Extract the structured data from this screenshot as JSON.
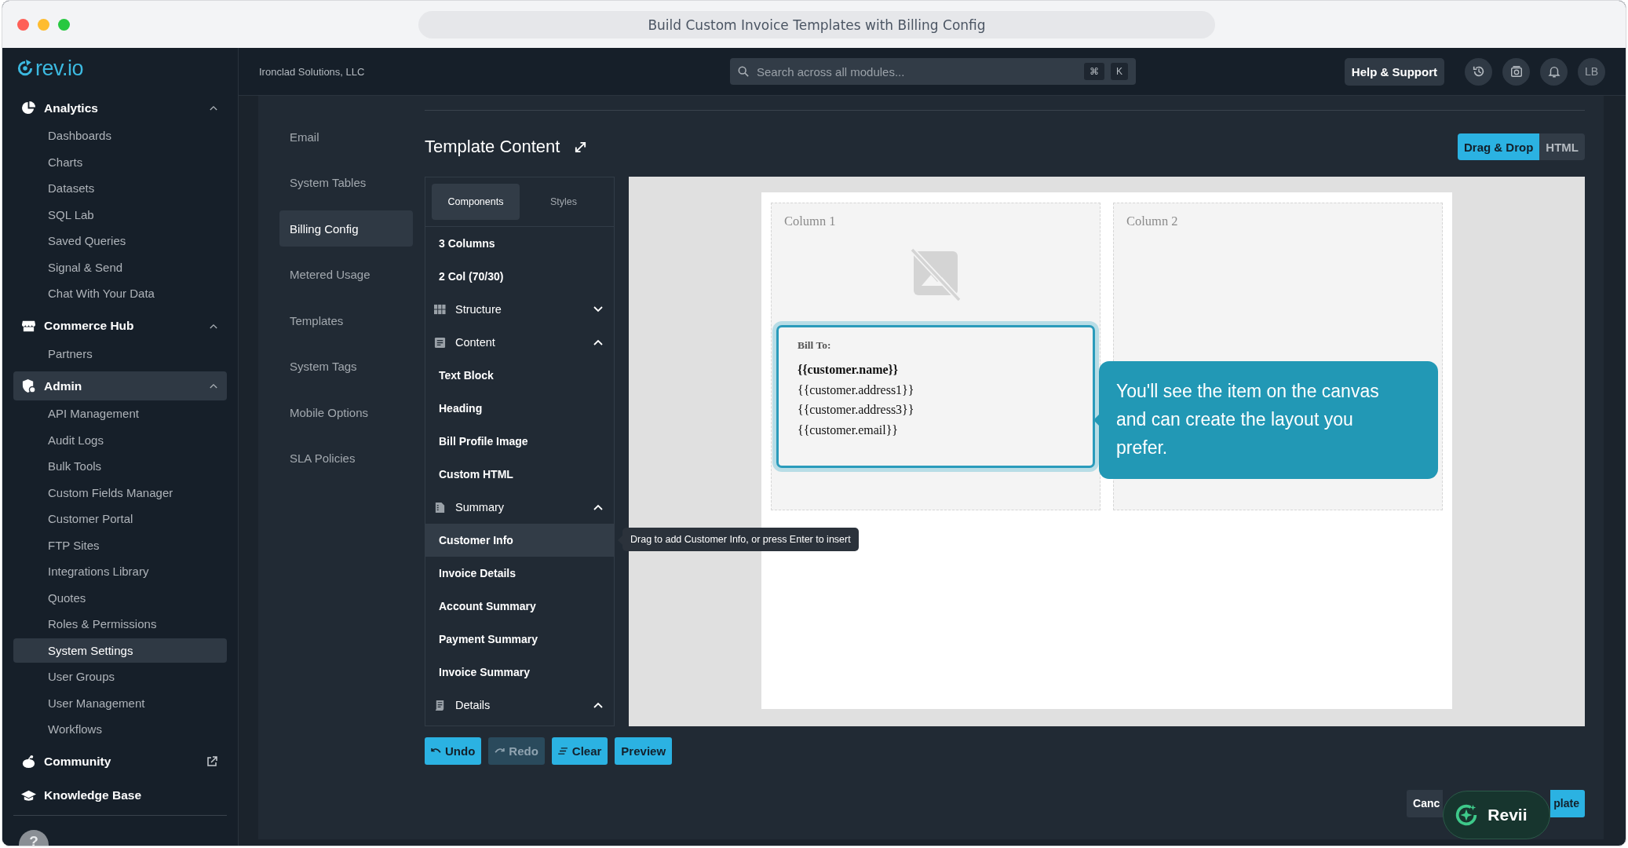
{
  "window": {
    "title": "Build Custom Invoice Templates with Billing Config"
  },
  "sidebar": {
    "logo": "rev.io",
    "sections": [
      {
        "label": "Analytics",
        "expanded": true,
        "selected": false,
        "items": [
          {
            "label": "Dashboards",
            "selected": false
          },
          {
            "label": "Charts",
            "selected": false
          },
          {
            "label": "Datasets",
            "selected": false
          },
          {
            "label": "SQL Lab",
            "selected": false
          },
          {
            "label": "Saved Queries",
            "selected": false
          },
          {
            "label": "Signal & Send",
            "selected": false
          },
          {
            "label": "Chat With Your Data",
            "selected": false
          }
        ]
      },
      {
        "label": "Commerce Hub",
        "expanded": true,
        "selected": false,
        "items": [
          {
            "label": "Partners",
            "selected": false
          }
        ]
      },
      {
        "label": "Admin",
        "expanded": true,
        "selected": true,
        "items": [
          {
            "label": "API Management",
            "selected": false
          },
          {
            "label": "Audit Logs",
            "selected": false
          },
          {
            "label": "Bulk Tools",
            "selected": false
          },
          {
            "label": "Custom Fields Manager",
            "selected": false
          },
          {
            "label": "Customer Portal",
            "selected": false
          },
          {
            "label": "FTP Sites",
            "selected": false
          },
          {
            "label": "Integrations Library",
            "selected": false
          },
          {
            "label": "Quotes",
            "selected": false
          },
          {
            "label": "Roles & Permissions",
            "selected": false
          },
          {
            "label": "System Settings",
            "selected": true
          },
          {
            "label": "User Groups",
            "selected": false
          },
          {
            "label": "User Management",
            "selected": false
          },
          {
            "label": "Workflows",
            "selected": false
          }
        ]
      },
      {
        "label": "Community",
        "selected": false,
        "external": true
      },
      {
        "label": "Knowledge Base",
        "selected": false
      }
    ],
    "help": "?"
  },
  "topbar": {
    "company": "Ironclad Solutions, LLC",
    "search": {
      "placeholder": "Search across all modules..."
    },
    "shortcut": [
      "⌘",
      "K"
    ],
    "help_button": "Help & Support",
    "avatar": "LB"
  },
  "settings_nav": [
    {
      "label": "Email",
      "selected": false
    },
    {
      "label": "System Tables",
      "selected": false
    },
    {
      "label": "Billing Config",
      "selected": true
    },
    {
      "label": "Metered Usage",
      "selected": false
    },
    {
      "label": "Templates",
      "selected": false
    },
    {
      "label": "System Tags",
      "selected": false
    },
    {
      "label": "Mobile Options",
      "selected": false
    },
    {
      "label": "SLA Policies",
      "selected": false
    }
  ],
  "editor": {
    "title": "Template Content",
    "modes": [
      {
        "label": "Drag & Drop",
        "selected": true
      },
      {
        "label": "HTML",
        "selected": false
      }
    ],
    "panel_tabs": [
      {
        "label": "Components",
        "selected": true
      },
      {
        "label": "Styles",
        "selected": false
      }
    ],
    "components": [
      {
        "kind": "item",
        "label": "3 Columns",
        "selected": false
      },
      {
        "kind": "item",
        "label": "2 Col (70/30)",
        "selected": false
      },
      {
        "kind": "group",
        "label": "Structure",
        "expanded": false
      },
      {
        "kind": "group",
        "label": "Content",
        "expanded": true
      },
      {
        "kind": "item",
        "label": "Text Block",
        "selected": false
      },
      {
        "kind": "item",
        "label": "Heading",
        "selected": false
      },
      {
        "kind": "item",
        "label": "Bill Profile Image",
        "selected": false
      },
      {
        "kind": "item",
        "label": "Custom HTML",
        "selected": false
      },
      {
        "kind": "group",
        "label": "Summary",
        "expanded": true
      },
      {
        "kind": "item",
        "label": "Customer Info",
        "selected": true
      },
      {
        "kind": "item",
        "label": "Invoice Details",
        "selected": false
      },
      {
        "kind": "item",
        "label": "Account Summary",
        "selected": false
      },
      {
        "kind": "item",
        "label": "Payment Summary",
        "selected": false
      },
      {
        "kind": "item",
        "label": "Invoice Summary",
        "selected": false
      },
      {
        "kind": "group",
        "label": "Details",
        "expanded": true
      }
    ],
    "tooltip": "Drag to add Customer Info, or press Enter to insert",
    "canvas": {
      "columns": [
        {
          "label": "Column 1"
        },
        {
          "label": "Column 2"
        }
      ],
      "bill_card": {
        "label": "Bill To:",
        "lines": [
          {
            "text": "{{customer.name}}",
            "bold": true
          },
          {
            "text": "{{customer.address1}}",
            "bold": false
          },
          {
            "text": "{{customer.address3}}",
            "bold": false
          },
          {
            "text": "{{customer.email}}",
            "bold": false
          }
        ]
      },
      "callout": "You'll see the item on the canvas and can create the layout you prefer."
    },
    "actions": [
      {
        "label": "Undo",
        "disabled": false
      },
      {
        "label": "Redo",
        "disabled": true
      },
      {
        "label": "Clear",
        "disabled": false
      },
      {
        "label": "Preview",
        "disabled": false
      }
    ],
    "footer": {
      "cancel": "Canc",
      "save": "plate"
    }
  },
  "assistant": {
    "label": "Revii"
  }
}
